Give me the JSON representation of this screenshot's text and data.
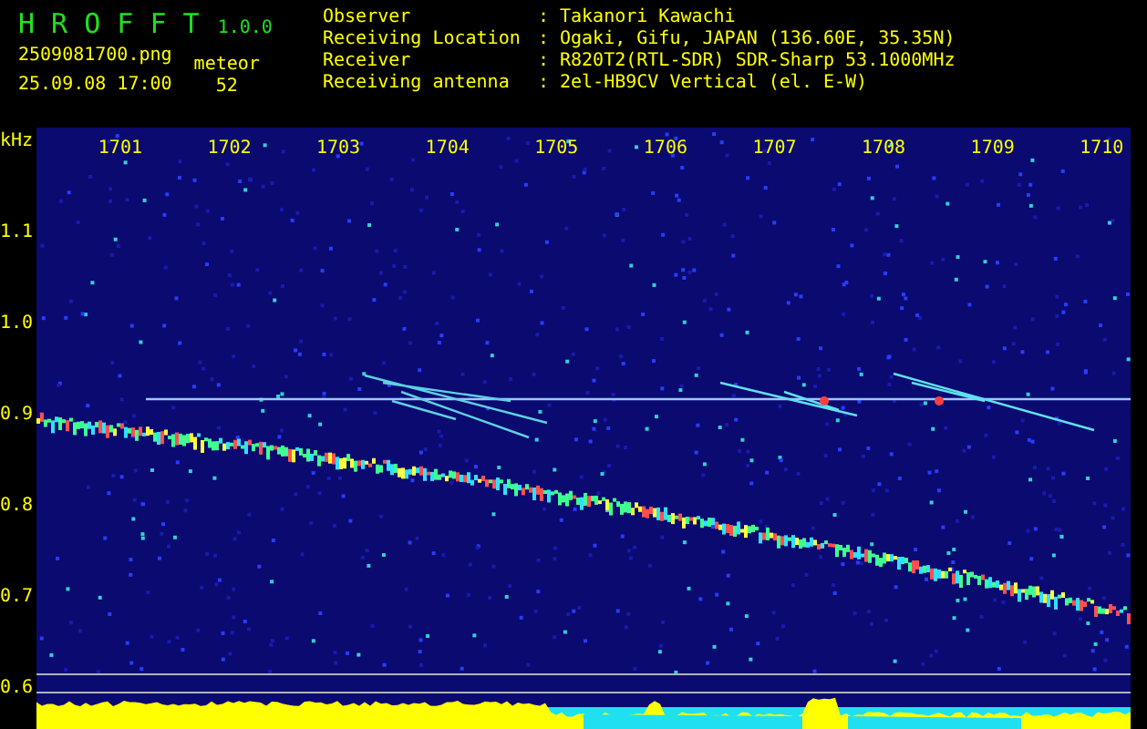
{
  "app": {
    "name": "H R O F F T",
    "version": "1.0.0"
  },
  "file": "2509081700.png",
  "datetime": "25.09.08 17:00",
  "meteor": {
    "label": "meteor",
    "count": "52"
  },
  "info": [
    {
      "label": "Observer",
      "separator": ":",
      "value": "Takanori Kawachi"
    },
    {
      "label": "Receiving Location",
      "separator": ":",
      "value": "Ogaki, Gifu, JAPAN (136.60E, 35.35N)"
    },
    {
      "label": "Receiver",
      "separator": ":",
      "value": "R820T2(RTL-SDR) SDR-Sharp 53.1000MHz"
    },
    {
      "label": "Receiving antenna",
      "separator": ":",
      "value": "2el-HB9CV Vertical (el. E-W)"
    }
  ],
  "spectrogram": {
    "unit": "kHz",
    "time_ticks": [
      "1701",
      "1702",
      "1703",
      "1704",
      "1705",
      "1706",
      "1707",
      "1708",
      "1709",
      "1710"
    ],
    "freq_ticks": [
      "1.1",
      "1.0",
      "0.9",
      "0.8",
      "0.7",
      "0.6"
    ]
  }
}
